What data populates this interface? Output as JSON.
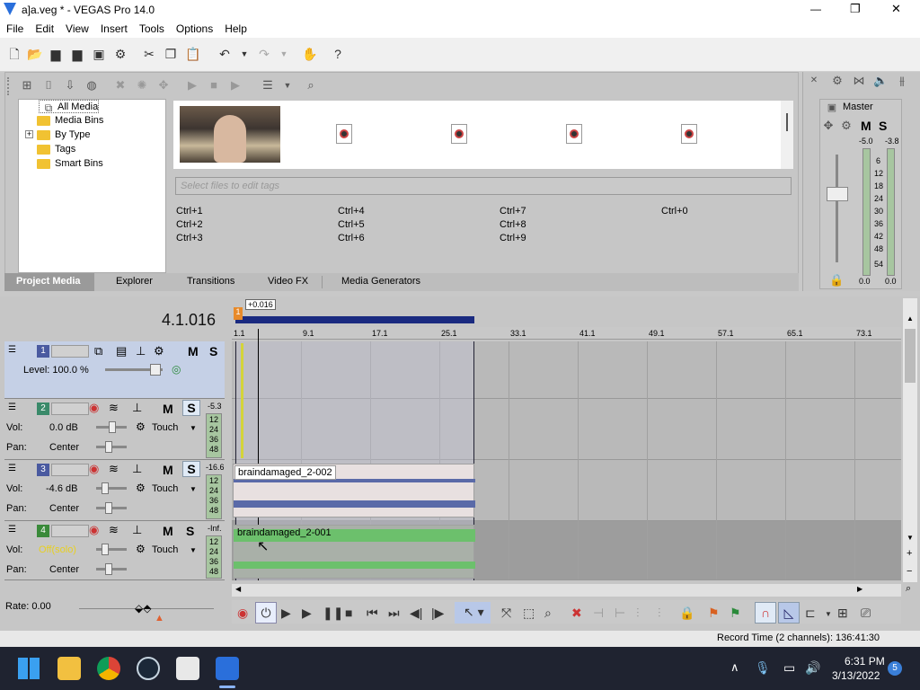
{
  "window": {
    "title": "a]a.veg * - VEGAS Pro 14.0",
    "controls": {
      "minimize": "—",
      "maximize": "❐",
      "close": "✕"
    }
  },
  "menu": [
    "File",
    "Edit",
    "View",
    "Insert",
    "Tools",
    "Options",
    "Help"
  ],
  "media_tree": {
    "items": [
      "All Media",
      "Media Bins",
      "By Type",
      "Tags",
      "Smart Bins"
    ],
    "expander": "+"
  },
  "tag_field": {
    "placeholder": "Select files to edit tags"
  },
  "shortcuts": [
    [
      "Ctrl+1",
      "Ctrl+2",
      "Ctrl+3"
    ],
    [
      "Ctrl+4",
      "Ctrl+5",
      "Ctrl+6"
    ],
    [
      "Ctrl+7",
      "Ctrl+8",
      "Ctrl+9"
    ],
    [
      "Ctrl+0"
    ]
  ],
  "tabs": [
    "Project Media",
    "Explorer",
    "Transitions",
    "Video FX",
    "Media Generators"
  ],
  "master": {
    "title": "Master",
    "m_label": "M",
    "s_label": "S",
    "peak_left": "-5.0",
    "peak_right": "-3.8",
    "scale": [
      "6",
      "12",
      "18",
      "24",
      "30",
      "36",
      "42",
      "48",
      "54"
    ],
    "bottom_left": "0.0",
    "bottom_right": "0.0"
  },
  "timeline": {
    "timecode": "4.1.016",
    "cursor_offset": "+0.016",
    "marker_label": "1",
    "ruler": [
      "1.1",
      "9.1",
      "17.1",
      "25.1",
      "33.1",
      "41.1",
      "49.1",
      "57.1",
      "65.1",
      "73.1"
    ]
  },
  "tracks": [
    {
      "num": "1",
      "type": "video",
      "level_label": "Level: 100.0 %",
      "m": "M",
      "s": "S"
    },
    {
      "num": "2",
      "type": "audio",
      "vol_label": "Vol:",
      "vol": "0.0 dB",
      "pan_label": "Pan:",
      "pan": "Center",
      "mode": "Touch",
      "peak": "-5.3",
      "m": "M",
      "s": "S",
      "meter_scale": [
        "12",
        "24",
        "36",
        "48"
      ]
    },
    {
      "num": "3",
      "type": "audio",
      "vol_label": "Vol:",
      "vol": "-4.6 dB",
      "pan_label": "Pan:",
      "pan": "Center",
      "mode": "Touch",
      "peak": "-16.6",
      "m": "M",
      "s": "S",
      "clip": "braindamaged_2-002",
      "meter_scale": [
        "12",
        "24",
        "36",
        "48"
      ]
    },
    {
      "num": "4",
      "type": "audio",
      "vol_label": "Vol:",
      "vol": "Off(solo)",
      "pan_label": "Pan:",
      "pan": "Center",
      "mode": "Touch",
      "peak": "-Inf.",
      "m": "M",
      "s": "S",
      "clip": "braindamaged_2-001",
      "meter_scale": [
        "12",
        "24",
        "36",
        "48"
      ]
    }
  ],
  "rate": "Rate: 0.00",
  "status": "Record Time (2 channels): 136:41:30",
  "taskbar": {
    "time": "6:31 PM",
    "date": "3/13/2022",
    "badge": "5"
  },
  "colors": {
    "accent": "#4a5aa0",
    "loop_region": "#1a2a80",
    "audio_green": "#6cc06c",
    "taskbar": "#1f2330"
  }
}
